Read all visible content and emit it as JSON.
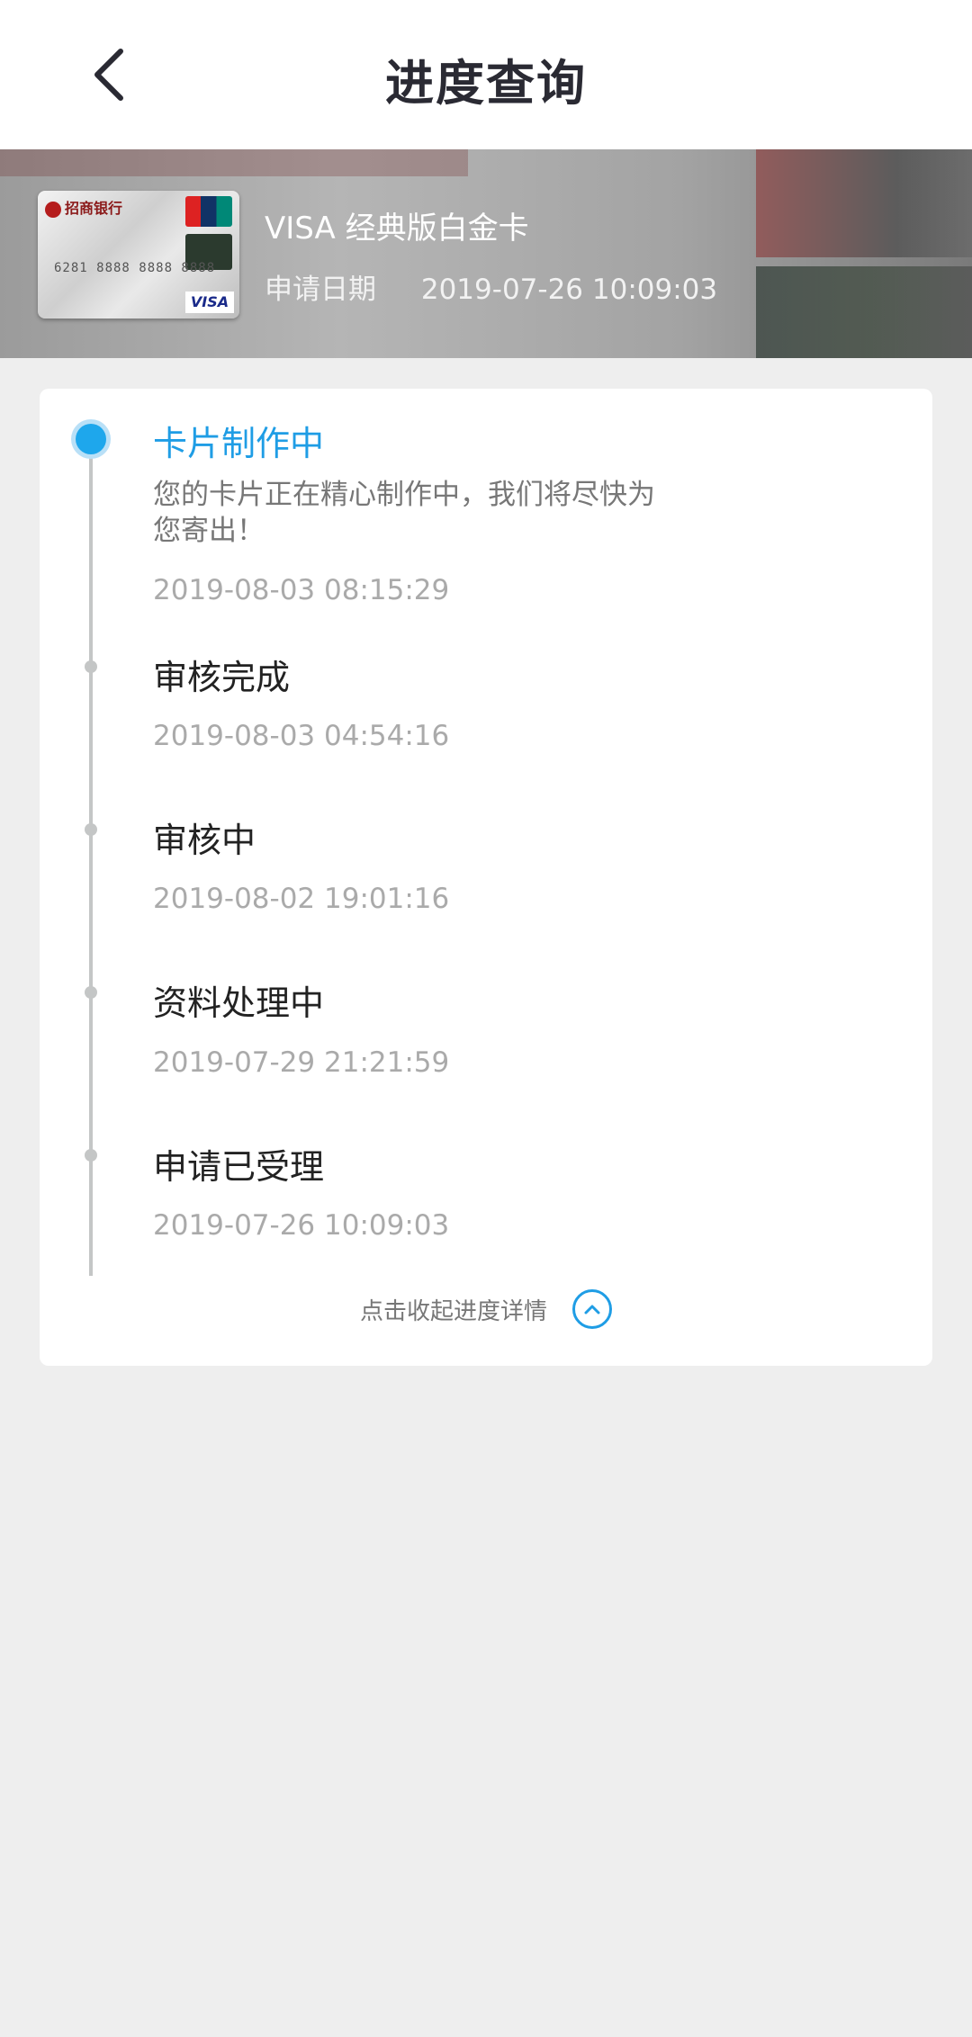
{
  "header": {
    "title": "进度查询",
    "back_icon": "chevron-left-icon"
  },
  "card": {
    "name": "VISA 经典版白金卡",
    "apply_date_label": "申请日期",
    "apply_date_value": "2019-07-26 10:09:03"
  },
  "timeline": {
    "steps": [
      {
        "title": "卡片制作中",
        "desc": "您的卡片正在精心制作中，我们将尽快为您寄出！",
        "time": "2019-08-03 08:15:29",
        "active": true
      },
      {
        "title": "审核完成",
        "time": "2019-08-03 04:54:16",
        "active": false
      },
      {
        "title": "审核中",
        "time": "2019-08-02 19:01:16",
        "active": false
      },
      {
        "title": "资料处理中",
        "time": "2019-07-29 21:21:59",
        "active": false
      },
      {
        "title": "申请已受理",
        "time": "2019-07-26 10:09:03",
        "active": false
      }
    ]
  },
  "collapse": {
    "label": "点击收起进度详情",
    "icon": "chevron-up-circle-icon"
  },
  "colors": {
    "accent": "#1f9de5",
    "background": "#eeeeee",
    "timeline_gray": "#c4c6c6"
  }
}
